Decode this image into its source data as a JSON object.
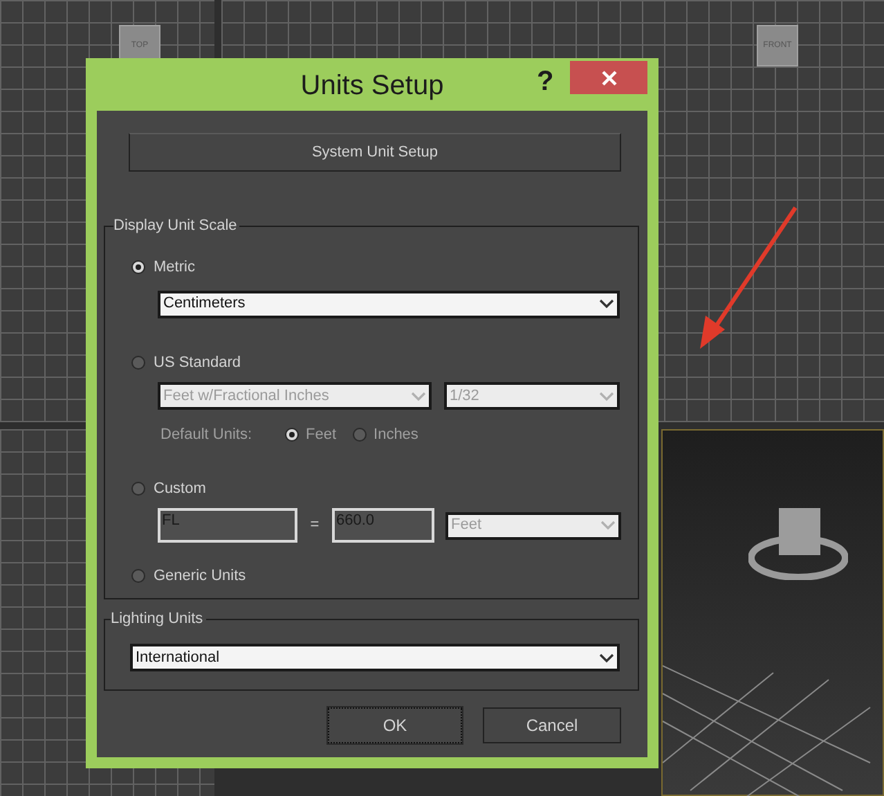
{
  "viewports": [
    {
      "kind": "grid",
      "label": "TOP"
    },
    {
      "kind": "grid",
      "label": "FRONT"
    },
    {
      "kind": "grid"
    },
    {
      "kind": "perspective"
    }
  ],
  "annotation": {
    "kind": "arrow"
  },
  "dialog": {
    "title": "Units Setup",
    "help": "?",
    "system_unit_button": "System Unit Setup",
    "display_unit_scale": {
      "title": "Display Unit Scale",
      "options": [
        {
          "label": "Metric",
          "selected": true
        },
        {
          "label": "US Standard",
          "selected": false
        },
        {
          "label": "Custom",
          "selected": false
        },
        {
          "label": "Generic Units",
          "selected": false
        }
      ],
      "metric_unit": {
        "value": "Centimeters",
        "disabled": false
      },
      "us_unit": {
        "value": "Feet w/Fractional Inches",
        "disabled": true
      },
      "us_fraction": {
        "value": "1/32",
        "disabled": true
      },
      "default_units_label": "Default Units:",
      "default_units": [
        {
          "label": "Feet",
          "selected": true
        },
        {
          "label": "Inches",
          "selected": false
        }
      ],
      "custom_name": "FL",
      "equals": "=",
      "custom_value": "660.0",
      "custom_unit": {
        "value": "Feet",
        "disabled": true
      }
    },
    "lighting_units": {
      "title": "Lighting Units",
      "value": "International"
    },
    "buttons": [
      {
        "label": "OK",
        "focused": true
      },
      {
        "label": "Cancel",
        "focused": false
      }
    ]
  }
}
